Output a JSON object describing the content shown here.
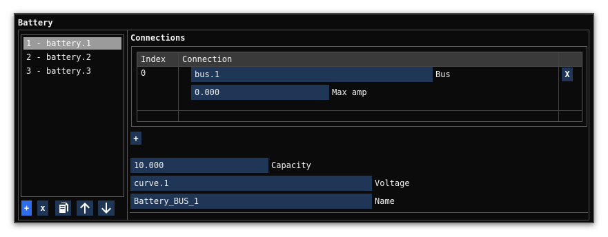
{
  "window": {
    "title": "Battery"
  },
  "battery_list": {
    "items": [
      {
        "label": "1 - battery.1",
        "selected": true
      },
      {
        "label": "2 - battery.2",
        "selected": false
      },
      {
        "label": "3 - battery.3",
        "selected": false
      }
    ]
  },
  "toolbar": {
    "add_label": "+",
    "remove_label": "x",
    "icons": [
      "copy-icon",
      "arrow-up-icon",
      "arrow-down-icon"
    ]
  },
  "connections": {
    "section_label": "Connections",
    "columns": [
      "Index",
      "Connection"
    ],
    "rows": [
      {
        "index": "0",
        "bus_value": "bus.1",
        "bus_label": "Bus",
        "max_amp_value": "0.000",
        "max_amp_label": "Max amp",
        "remove_label": "X"
      }
    ],
    "add_label": "+"
  },
  "properties": {
    "capacity": {
      "value": "10.000",
      "label": "Capacity"
    },
    "voltage": {
      "value": "curve.1",
      "label": "Voltage"
    },
    "name": {
      "value": "Battery_BUS_1",
      "label": "Name"
    }
  },
  "colors": {
    "background": "#0b0b0c",
    "field": "#1f3657",
    "selected_item": "#9b9b9b",
    "accent_button": "#2f6ee8"
  }
}
